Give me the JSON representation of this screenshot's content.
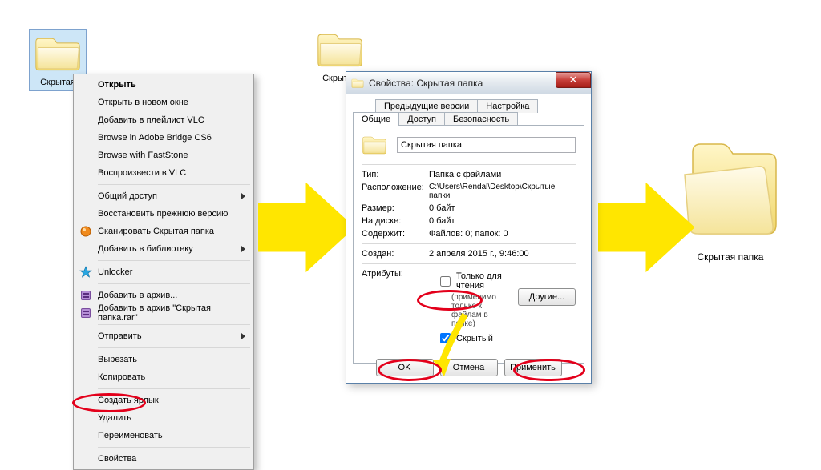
{
  "folder1": {
    "label": "Скрытая"
  },
  "folder2": {
    "label": "Скрытая"
  },
  "folder3": {
    "label": "Скрытая папка"
  },
  "context_menu": {
    "open": "Открыть",
    "open_new_window": "Открыть в новом окне",
    "add_playlist_vlc": "Добавить в плейлист VLC",
    "browse_bridge": "Browse in Adobe Bridge CS6",
    "browse_faststone": "Browse with FastStone",
    "play_vlc": "Воспроизвести в VLC",
    "sharing": "Общий доступ",
    "restore_prev": "Восстановить прежнюю версию",
    "scan_hidden": "Сканировать Скрытая папка",
    "add_library": "Добавить в библиотеку",
    "unlocker": "Unlocker",
    "add_archive": "Добавить в архив...",
    "add_archive_named": "Добавить в архив \"Скрытая папка.rar\"",
    "send_to": "Отправить",
    "cut": "Вырезать",
    "copy": "Копировать",
    "create_shortcut": "Создать ярлык",
    "delete": "Удалить",
    "rename": "Переименовать",
    "properties": "Свойства"
  },
  "dialog": {
    "title": "Свойства: Скрытая папка",
    "tabs": {
      "prev_versions": "Предыдущие версии",
      "customize": "Настройка",
      "general": "Общие",
      "access": "Доступ",
      "security": "Безопасность"
    },
    "name_value": "Скрытая папка",
    "rows": {
      "type_k": "Тип:",
      "type_v": "Папка с файлами",
      "loc_k": "Расположение:",
      "loc_v": "C:\\Users\\Rendal\\Desktop\\Скрытые папки",
      "size_k": "Размер:",
      "size_v": "0 байт",
      "ondisk_k": "На диске:",
      "ondisk_v": "0 байт",
      "contains_k": "Содержит:",
      "contains_v": "Файлов: 0; папок: 0",
      "created_k": "Создан:",
      "created_v": "2 апреля 2015 г., 9:46:00",
      "attrs_k": "Атрибуты:"
    },
    "readonly_label": "Только для чтения",
    "readonly_note": "(применимо только к файлам в папке)",
    "hidden_label": "Скрытый",
    "other_btn": "Другие...",
    "ok": "OK",
    "cancel": "Отмена",
    "apply": "Применить"
  }
}
